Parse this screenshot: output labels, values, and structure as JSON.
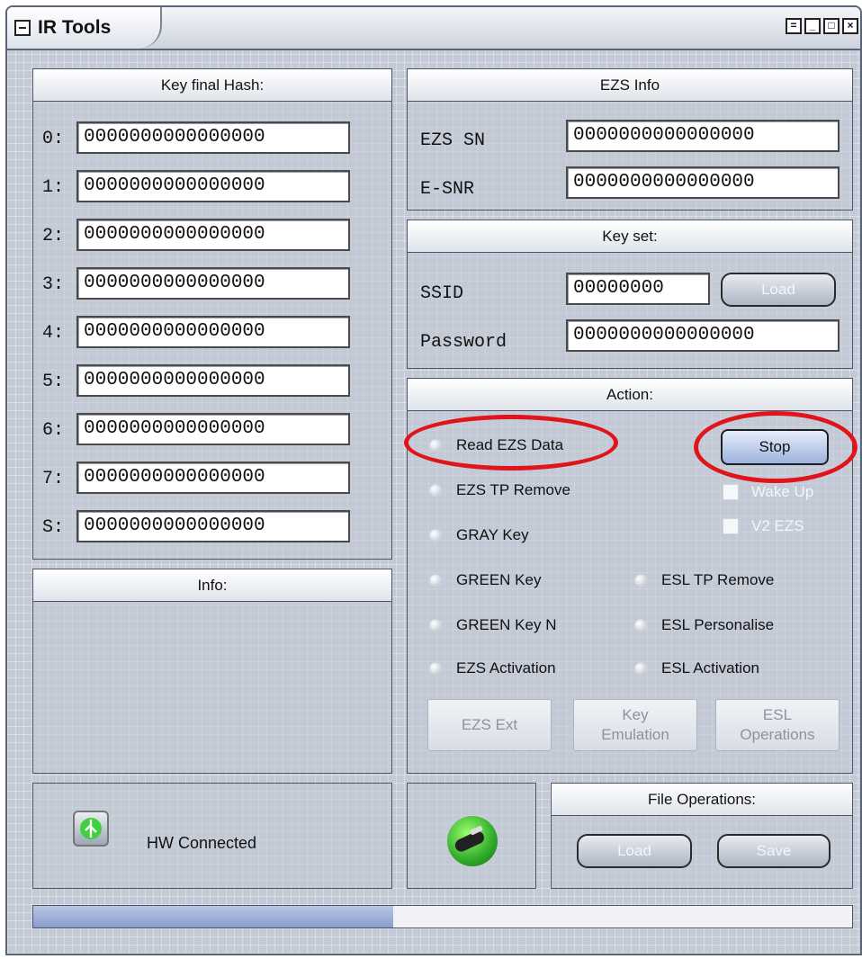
{
  "window": {
    "title": "IR Tools"
  },
  "key_hash": {
    "header": "Key final Hash:",
    "rows": [
      {
        "label": "0:",
        "value": "0000000000000000"
      },
      {
        "label": "1:",
        "value": "0000000000000000"
      },
      {
        "label": "2:",
        "value": "0000000000000000"
      },
      {
        "label": "3:",
        "value": "0000000000000000"
      },
      {
        "label": "4:",
        "value": "0000000000000000"
      },
      {
        "label": "5:",
        "value": "0000000000000000"
      },
      {
        "label": "6:",
        "value": "0000000000000000"
      },
      {
        "label": "7:",
        "value": "0000000000000000"
      },
      {
        "label": "S:",
        "value": "0000000000000000"
      }
    ]
  },
  "ezs_info": {
    "header": "EZS Info",
    "ezs_sn_label": "EZS SN",
    "ezs_sn_value": "0000000000000000",
    "esnr_label": "E-SNR",
    "esnr_value": "0000000000000000"
  },
  "key_set": {
    "header": "Key set:",
    "ssid_label": "SSID",
    "ssid_value": "00000000",
    "load_label": "Load",
    "password_label": "Password",
    "password_value": "0000000000000000"
  },
  "action": {
    "header": "Action:",
    "radios": {
      "read_ezs": "Read EZS Data",
      "ezs_tp_remove": "EZS TP Remove",
      "gray_key": "GRAY Key",
      "green_key": "GREEN Key",
      "green_key_n": "GREEN Key N",
      "ezs_activation": "EZS Activation",
      "esl_tp_remove": "ESL TP Remove",
      "esl_personalise": "ESL Personalise",
      "esl_activation": "ESL Activation"
    },
    "stop_label": "Stop",
    "wake_up_label": "Wake Up",
    "v2_ezs_label": "V2 EZS",
    "ezs_ext_label": "EZS Ext",
    "key_emulation_line1": "Key",
    "key_emulation_line2": "Emulation",
    "esl_operations_line1": "ESL",
    "esl_operations_line2": "Operations"
  },
  "info": {
    "header": "Info:"
  },
  "status": {
    "hw_label": "HW Connected"
  },
  "file_ops": {
    "header": "File Operations:",
    "load_label": "Load",
    "save_label": "Save"
  },
  "progress": {
    "fraction": 0.44
  },
  "colors": {
    "highlight_ellipse": "#e0141b",
    "stop_button": "#9db3dc"
  },
  "icons": [
    "usb-icon",
    "car-key-icon"
  ]
}
